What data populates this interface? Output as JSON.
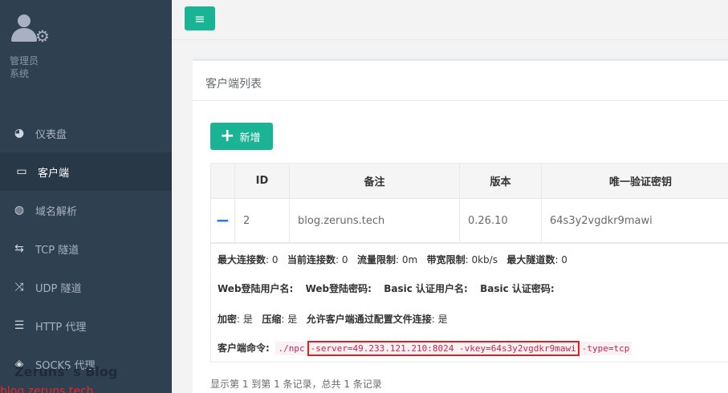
{
  "sidebar": {
    "profile": {
      "line1": "管理员",
      "line2": "系统"
    },
    "items": [
      {
        "label": "仪表盘",
        "icon": "dashboard-icon"
      },
      {
        "label": "客户端",
        "icon": "desktop-icon"
      },
      {
        "label": "域名解析",
        "icon": "globe-icon"
      },
      {
        "label": "TCP 隧道",
        "icon": "exchange-icon"
      },
      {
        "label": "UDP 隧道",
        "icon": "random-icon"
      },
      {
        "label": "HTTP 代理",
        "icon": "server-icon"
      },
      {
        "label": "SOCKS 代理",
        "icon": "layers-icon"
      }
    ],
    "watermark": "Zeruns' s Blog",
    "watermark2": "blog.zeruns.tech"
  },
  "panel": {
    "title": "客户端列表",
    "add_label": "新增",
    "columns": [
      "ID",
      "备注",
      "版本",
      "唯一验证密钥"
    ],
    "rows": [
      {
        "id": "2",
        "remark": "blog.zeruns.tech",
        "version": "0.26.10",
        "key": "64s3y2vgdkr9mawi"
      }
    ],
    "detail": {
      "max_conn_label": "最大连接数",
      "max_conn": "0",
      "cur_conn_label": "当前连接数",
      "cur_conn": "0",
      "flow_label": "流量限制",
      "flow": "0m",
      "bw_label": "带宽限制",
      "bw": "0kb/s",
      "tunnels_label": "最大隧道数",
      "tunnels": "0",
      "web_user_label": "Web登陆用户名:",
      "web_pass_label": "Web登陆密码:",
      "basic_user_label": "Basic 认证用户名:",
      "basic_pass_label": "Basic 认证密码:",
      "encrypt_label": "加密",
      "encrypt": "是",
      "compress_label": "压缩",
      "compress": "是",
      "allow_label": "允许客户端通过配置文件连接",
      "allow": "是",
      "cmd_label": "客户端命令:",
      "cmd_prefix": "./npc",
      "cmd_highlight": "-server=49.233.121.210:8024 -vkey=64s3y2vgdkr9mawi",
      "cmd_suffix": "-type=tcp"
    },
    "footer": "显示第 1 到第 1 条记录，总共 1 条记录"
  },
  "colors": {
    "sidebar": "#2f4050",
    "accent": "#1ab394",
    "highlight": "#e02020"
  }
}
